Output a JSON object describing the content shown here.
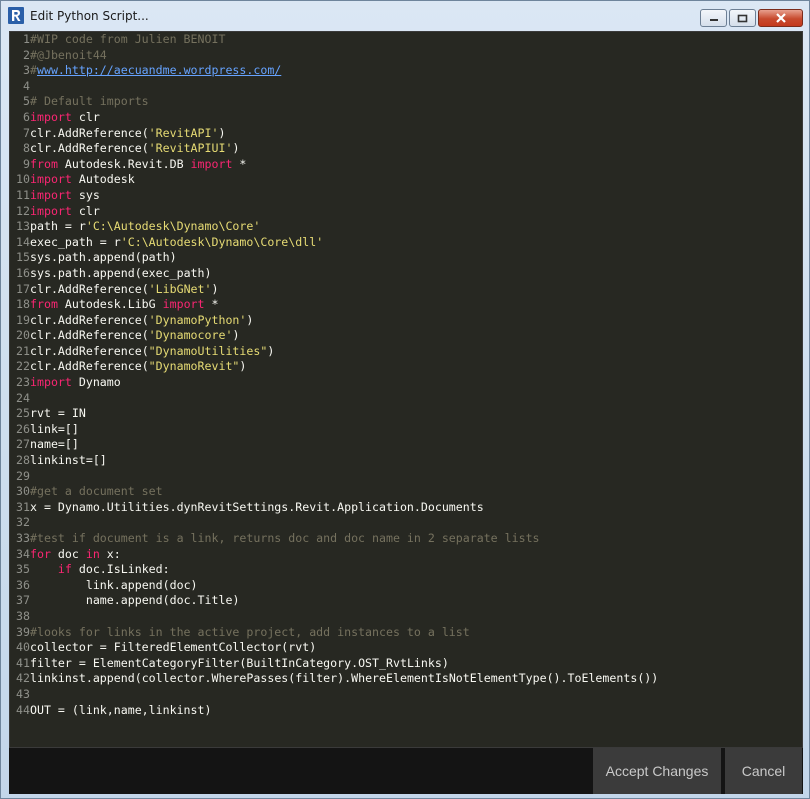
{
  "window": {
    "title": "Edit Python Script..."
  },
  "footer": {
    "accept_label": "Accept Changes",
    "cancel_label": "Cancel"
  },
  "code": [
    [
      [
        "c",
        "#WIP code from Julien BENOIT"
      ]
    ],
    [
      [
        "c",
        "#@Jbenoit44"
      ]
    ],
    [
      [
        "c",
        "#"
      ],
      [
        "u",
        "www.http://aecuandme.wordpress.com/"
      ]
    ],
    [],
    [
      [
        "c",
        "# Default imports"
      ]
    ],
    [
      [
        "k",
        "import"
      ],
      [
        "n",
        " clr"
      ]
    ],
    [
      [
        "n",
        "clr."
      ],
      [
        "n",
        "AddReference"
      ],
      [
        "n",
        "("
      ],
      [
        "s",
        "'RevitAPI'"
      ],
      [
        "n",
        ")"
      ]
    ],
    [
      [
        "n",
        "clr."
      ],
      [
        "n",
        "AddReference"
      ],
      [
        "n",
        "("
      ],
      [
        "s",
        "'RevitAPIUI'"
      ],
      [
        "n",
        ")"
      ]
    ],
    [
      [
        "k",
        "from"
      ],
      [
        "n",
        " Autodesk.Revit.DB "
      ],
      [
        "k",
        "import"
      ],
      [
        "n",
        " *"
      ]
    ],
    [
      [
        "k",
        "import"
      ],
      [
        "n",
        " Autodesk"
      ]
    ],
    [
      [
        "k",
        "import"
      ],
      [
        "n",
        " sys"
      ]
    ],
    [
      [
        "k",
        "import"
      ],
      [
        "n",
        " clr"
      ]
    ],
    [
      [
        "n",
        "path = r"
      ],
      [
        "s",
        "'C:\\Autodesk\\Dynamo\\Core'"
      ]
    ],
    [
      [
        "n",
        "exec_path = r"
      ],
      [
        "s",
        "'C:\\Autodesk\\Dynamo\\Core\\dll'"
      ]
    ],
    [
      [
        "n",
        "sys.path."
      ],
      [
        "n",
        "append"
      ],
      [
        "n",
        "(path)"
      ]
    ],
    [
      [
        "n",
        "sys.path."
      ],
      [
        "n",
        "append"
      ],
      [
        "n",
        "(exec_path)"
      ]
    ],
    [
      [
        "n",
        "clr."
      ],
      [
        "n",
        "AddReference"
      ],
      [
        "n",
        "("
      ],
      [
        "s",
        "'LibGNet'"
      ],
      [
        "n",
        ")"
      ]
    ],
    [
      [
        "k",
        "from"
      ],
      [
        "n",
        " Autodesk.LibG "
      ],
      [
        "k",
        "import"
      ],
      [
        "n",
        " *"
      ]
    ],
    [
      [
        "n",
        "clr."
      ],
      [
        "n",
        "AddReference"
      ],
      [
        "n",
        "("
      ],
      [
        "s",
        "'DynamoPython'"
      ],
      [
        "n",
        ")"
      ]
    ],
    [
      [
        "n",
        "clr."
      ],
      [
        "n",
        "AddReference"
      ],
      [
        "n",
        "("
      ],
      [
        "s",
        "'Dynamocore'"
      ],
      [
        "n",
        ")"
      ]
    ],
    [
      [
        "n",
        "clr."
      ],
      [
        "n",
        "AddReference"
      ],
      [
        "n",
        "("
      ],
      [
        "s",
        "\"DynamoUtilities\""
      ],
      [
        "n",
        ")"
      ]
    ],
    [
      [
        "n",
        "clr."
      ],
      [
        "n",
        "AddReference"
      ],
      [
        "n",
        "("
      ],
      [
        "s",
        "\"DynamoRevit\""
      ],
      [
        "n",
        ")"
      ]
    ],
    [
      [
        "k",
        "import"
      ],
      [
        "n",
        " Dynamo"
      ]
    ],
    [],
    [
      [
        "n",
        "rvt = IN"
      ]
    ],
    [
      [
        "n",
        "link=[]"
      ]
    ],
    [
      [
        "n",
        "name=[]"
      ]
    ],
    [
      [
        "n",
        "linkinst=[]"
      ]
    ],
    [],
    [
      [
        "c",
        "#get a document set"
      ]
    ],
    [
      [
        "n",
        "x = Dynamo.Utilities.dynRevitSettings.Revit.Application.Documents"
      ]
    ],
    [],
    [
      [
        "c",
        "#test if document is a link, returns doc and doc name in 2 separate lists"
      ]
    ],
    [
      [
        "k",
        "for"
      ],
      [
        "n",
        " doc "
      ],
      [
        "k",
        "in"
      ],
      [
        "n",
        " x:"
      ]
    ],
    [
      [
        "n",
        "    "
      ],
      [
        "k",
        "if"
      ],
      [
        "n",
        " doc.IsLinked:"
      ]
    ],
    [
      [
        "n",
        "        link."
      ],
      [
        "n",
        "append"
      ],
      [
        "n",
        "(doc)"
      ]
    ],
    [
      [
        "n",
        "        name."
      ],
      [
        "n",
        "append"
      ],
      [
        "n",
        "(doc.Title)"
      ]
    ],
    [],
    [
      [
        "c",
        "#looks for links in the active project, add instances to a list"
      ]
    ],
    [
      [
        "n",
        "collector = "
      ],
      [
        "n",
        "FilteredElementCollector"
      ],
      [
        "n",
        "(rvt)"
      ]
    ],
    [
      [
        "n",
        "filter = "
      ],
      [
        "n",
        "ElementCategoryFilter"
      ],
      [
        "n",
        "(BuiltInCategory.OST_RvtLinks)"
      ]
    ],
    [
      [
        "n",
        "linkinst."
      ],
      [
        "n",
        "append"
      ],
      [
        "n",
        "(collector."
      ],
      [
        "n",
        "WherePasses"
      ],
      [
        "n",
        "(filter)."
      ],
      [
        "n",
        "WhereElementIsNotElementType"
      ],
      [
        "n",
        "()."
      ],
      [
        "n",
        "ToElements"
      ],
      [
        "n",
        "())"
      ]
    ],
    [],
    [
      [
        "n",
        "OUT = (link,name,linkinst)"
      ]
    ]
  ],
  "colors": {
    "editor_bg": "#272822",
    "comment": "#75715e",
    "keyword": "#f92672",
    "string": "#e6db74",
    "link": "#66a3ff",
    "text": "#f8f8f2"
  }
}
